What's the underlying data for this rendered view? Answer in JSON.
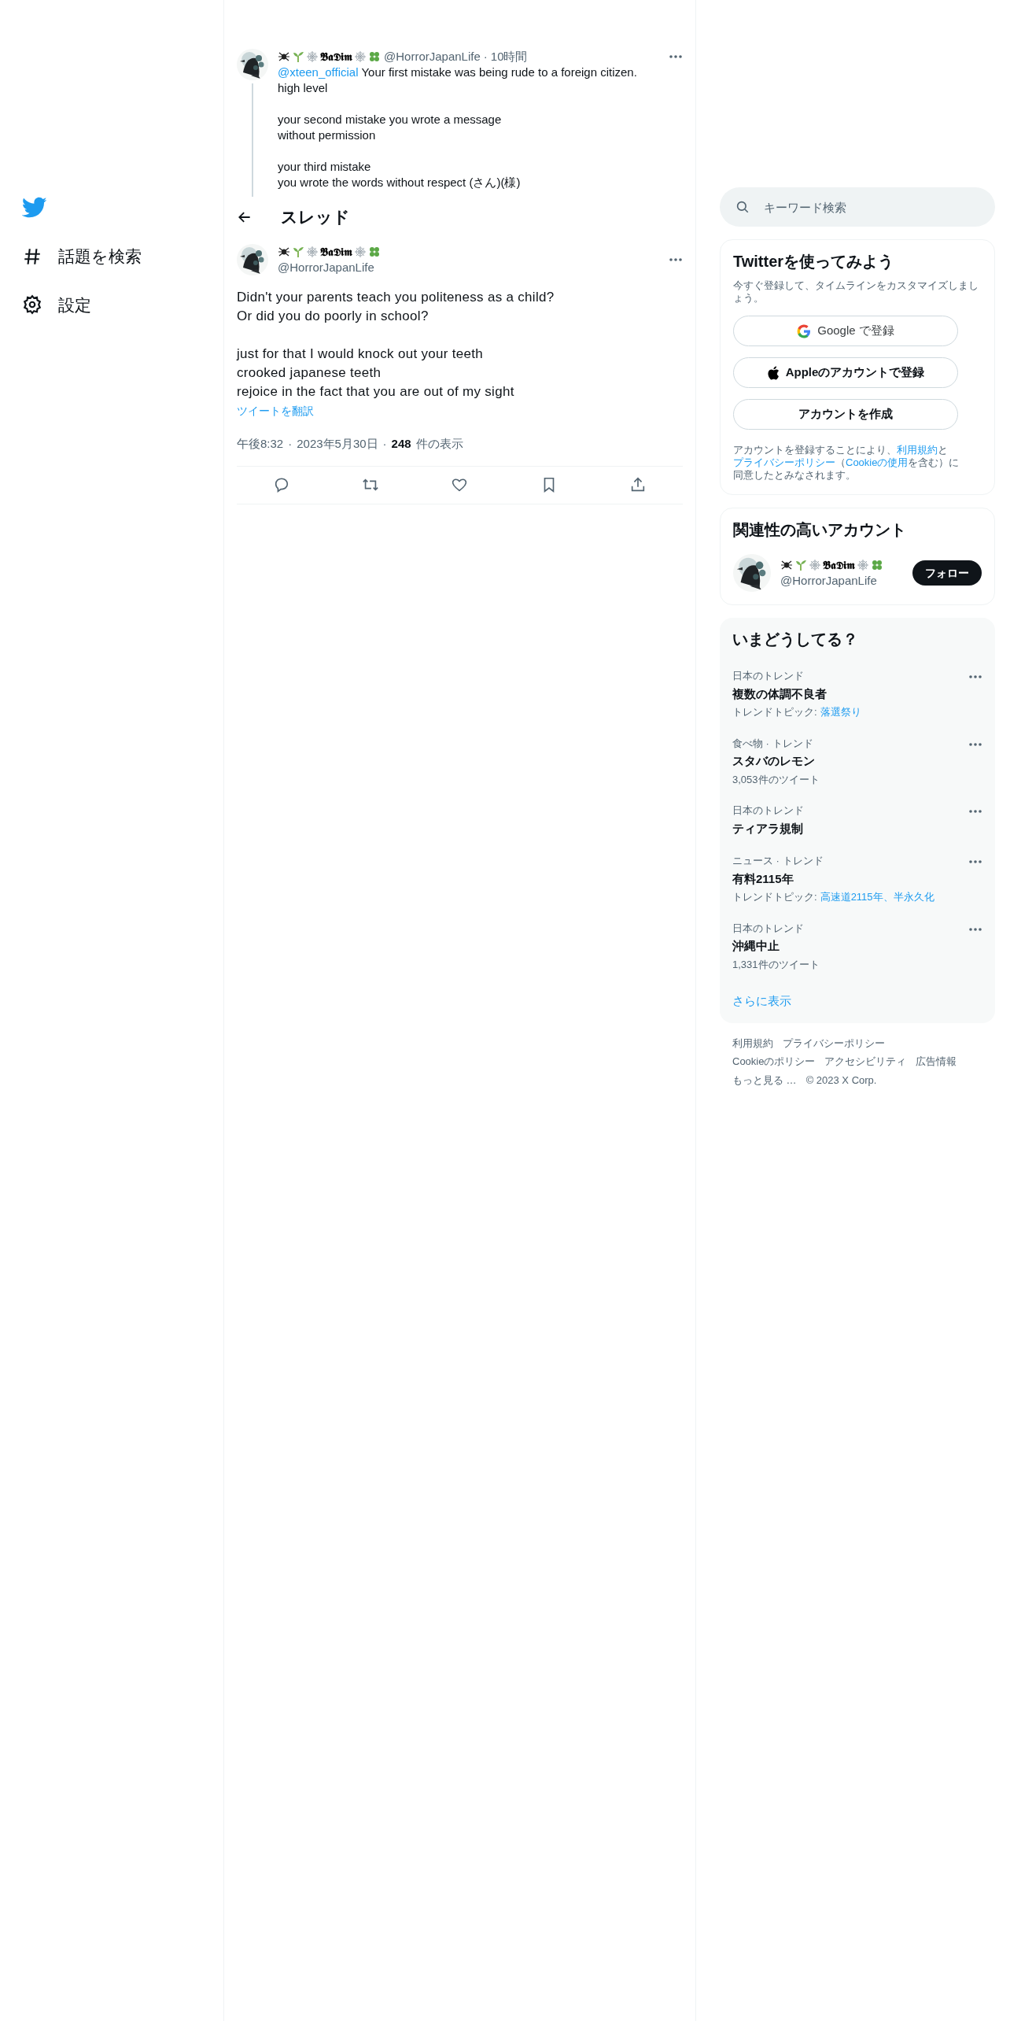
{
  "sidebar": {
    "items": [
      {
        "kind": "explore",
        "label": "話題を検索"
      },
      {
        "kind": "settings",
        "label": "設定"
      }
    ]
  },
  "parent_tweet": {
    "display_name": "𝕭𝖆𝕯𝖎𝖒",
    "handle": "@HorrorJapanLife",
    "separator": "·",
    "time": "10時間",
    "mention": "@xteen_official",
    "text": "Your first mistake was being rude to a foreign citizen.\nhigh level\n\nyour second mistake you wrote a message\nwithout permission\n\nyour third mistake\nyou wrote the words without respect (さん)(様)"
  },
  "header": {
    "title": "スレッド"
  },
  "tweet": {
    "display_name": "𝕭𝖆𝕯𝖎𝖒",
    "handle": "@HorrorJapanLife",
    "text": "Didn't your parents teach you politeness as a child?\nOr did you do poorly in school?\n\njust for that I would knock out your teeth\ncrooked japanese teeth\nrejoice in the fact that you are out of my sight",
    "translate": "ツイートを翻訳",
    "time": "午後8:32",
    "date": "2023年5月30日",
    "views_count": "248",
    "views_label": "件の表示",
    "separator": "·"
  },
  "search": {
    "placeholder": "キーワード検索"
  },
  "signup": {
    "title": "Twitterを使ってみよう",
    "subtitle": "今すぐ登録して、タイムラインをカスタマイズしましょう。",
    "buttons": [
      {
        "kind": "google",
        "label": "Google で登録"
      },
      {
        "kind": "apple",
        "label": "Appleのアカウントで登録"
      },
      {
        "kind": "plain",
        "label": "アカウントを作成"
      }
    ],
    "legal": [
      {
        "text": "アカウントを登録することにより、",
        "link": false
      },
      {
        "text": "利用規約",
        "link": true
      },
      {
        "text": "と",
        "link": false
      },
      {
        "text": "プライバシーポリシー",
        "link": true
      },
      {
        "text": "（",
        "link": false
      },
      {
        "text": "Cookieの使用",
        "link": true
      },
      {
        "text": "を含む）に同意したとみなされます。",
        "link": false
      }
    ]
  },
  "relevant": {
    "title": "関連性の高いアカウント",
    "display_name": "𝕭𝖆𝕯𝖎𝖒",
    "handle": "@HorrorJapanLife",
    "follow": "フォロー"
  },
  "trends": {
    "title": "いまどうしてる？",
    "items": [
      {
        "context": "日本のトレンド",
        "name": "複数の体調不良者",
        "topic_label": "トレンドトピック:",
        "topics": "落選祭り"
      },
      {
        "context": "食べ物 · トレンド",
        "name": "スタバのレモン",
        "count": "3,053件のツイート"
      },
      {
        "context": "日本のトレンド",
        "name": "ティアラ規制"
      },
      {
        "context": "ニュース · トレンド",
        "name": "有料2115年",
        "topic_label": "トレンドトピック:",
        "topics": "高速道2115年、半永久化"
      },
      {
        "context": "日本のトレンド",
        "name": "沖縄中止",
        "count": "1,331件のツイート"
      }
    ],
    "more": "さらに表示"
  },
  "footer": {
    "links": [
      "利用規約",
      "プライバシーポリシー",
      "Cookieのポリシー",
      "アクセシビリティ",
      "広告情報",
      "もっと見る …"
    ],
    "copyright": "© 2023 X Corp."
  }
}
